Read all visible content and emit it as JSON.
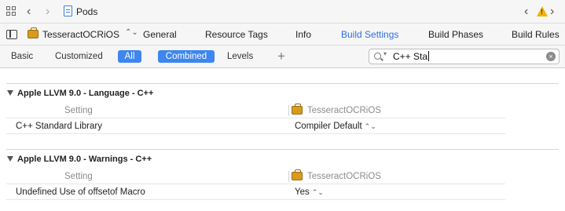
{
  "jump_bar": {
    "title": "Pods",
    "back_glyph": "‹",
    "forward_glyph": "›",
    "icons": [
      "grid-icon",
      "file-icon",
      "warning-icon"
    ]
  },
  "tab_bar": {
    "target": "TesseractOCRiOS",
    "target_arrows": "⌃⌄",
    "tabs": [
      {
        "label": "General",
        "active": false
      },
      {
        "label": "Resource Tags",
        "active": false
      },
      {
        "label": "Info",
        "active": false
      },
      {
        "label": "Build Settings",
        "active": true
      },
      {
        "label": "Build Phases",
        "active": false
      },
      {
        "label": "Build Rules",
        "active": false
      }
    ]
  },
  "filter_bar": {
    "basic": "Basic",
    "customized": "Customized",
    "all": "All",
    "combined": "Combined",
    "levels": "Levels",
    "plus": "+",
    "search_value": "C++ Sta",
    "search_clear": "×"
  },
  "sections": [
    {
      "title": "Apple LLVM 9.0 - Language - C++",
      "column_setting": "Setting",
      "column_target": "TesseractOCRiOS",
      "rows": [
        {
          "name": "C++ Standard Library",
          "value": "Compiler Default"
        }
      ]
    },
    {
      "title": "Apple LLVM 9.0 - Warnings - C++",
      "column_setting": "Setting",
      "column_target": "TesseractOCRiOS",
      "rows": [
        {
          "name": "Undefined Use of offsetof Macro",
          "value": "Yes"
        }
      ]
    }
  ],
  "colors": {
    "accent": "#3e86f0",
    "active_tab": "#2f6fe0",
    "warning": "#f0b400",
    "briefcase": "#d99a1e"
  }
}
